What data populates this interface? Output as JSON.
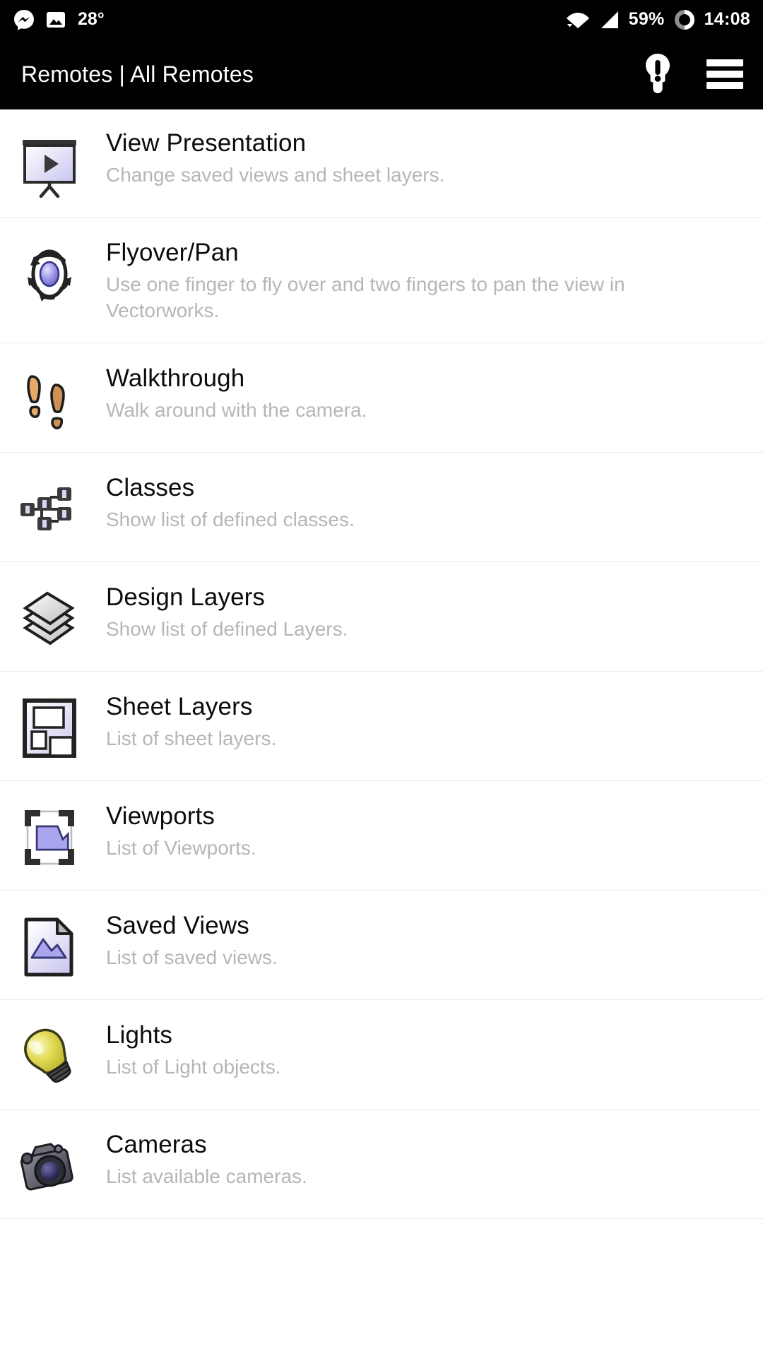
{
  "statusbar": {
    "messenger_icon": "messenger-icon",
    "photo_icon": "photo-icon",
    "temperature": "28°",
    "wifi_icon": "wifi-icon",
    "signal_icon": "cell-signal-icon",
    "battery_percent": "59%",
    "battery_icon": "battery-ring-icon",
    "clock": "14:08"
  },
  "appbar": {
    "title": "Remotes | All Remotes",
    "tips_icon": "lightbulb-alert-icon",
    "menu_icon": "hamburger-menu-icon"
  },
  "list": {
    "items": [
      {
        "icon": "presentation-screen-icon",
        "title": "View Presentation",
        "subtitle": "Change saved views and sheet layers."
      },
      {
        "icon": "flyover-orbit-icon",
        "title": "Flyover/Pan",
        "subtitle": "Use one finger to fly over and two fingers to pan the view in Vectorworks."
      },
      {
        "icon": "footprints-icon",
        "title": "Walkthrough",
        "subtitle": "Walk around with the camera."
      },
      {
        "icon": "class-hierarchy-icon",
        "title": "Classes",
        "subtitle": "Show list of defined classes."
      },
      {
        "icon": "stacked-layers-icon",
        "title": "Design Layers",
        "subtitle": "Show list of defined Layers."
      },
      {
        "icon": "sheet-layout-icon",
        "title": "Sheet Layers",
        "subtitle": "List of sheet layers."
      },
      {
        "icon": "viewport-cropmarks-icon",
        "title": "Viewports",
        "subtitle": "List of Viewports."
      },
      {
        "icon": "saved-view-document-icon",
        "title": "Saved Views",
        "subtitle": "List of saved views."
      },
      {
        "icon": "lightbulb-icon",
        "title": "Lights",
        "subtitle": "List of Light objects."
      },
      {
        "icon": "camera-icon",
        "title": "Cameras",
        "subtitle": "List available cameras."
      }
    ]
  },
  "colors": {
    "appbar_bg": "#000000",
    "page_bg": "#ffffff",
    "title_text": "#0c0c0c",
    "subtitle_text": "#b6b6b6",
    "divider": "#eceaea",
    "accent_purple": "#a9a6ee",
    "accent_yellow": "#d9d33f",
    "accent_tan": "#e0a363"
  }
}
